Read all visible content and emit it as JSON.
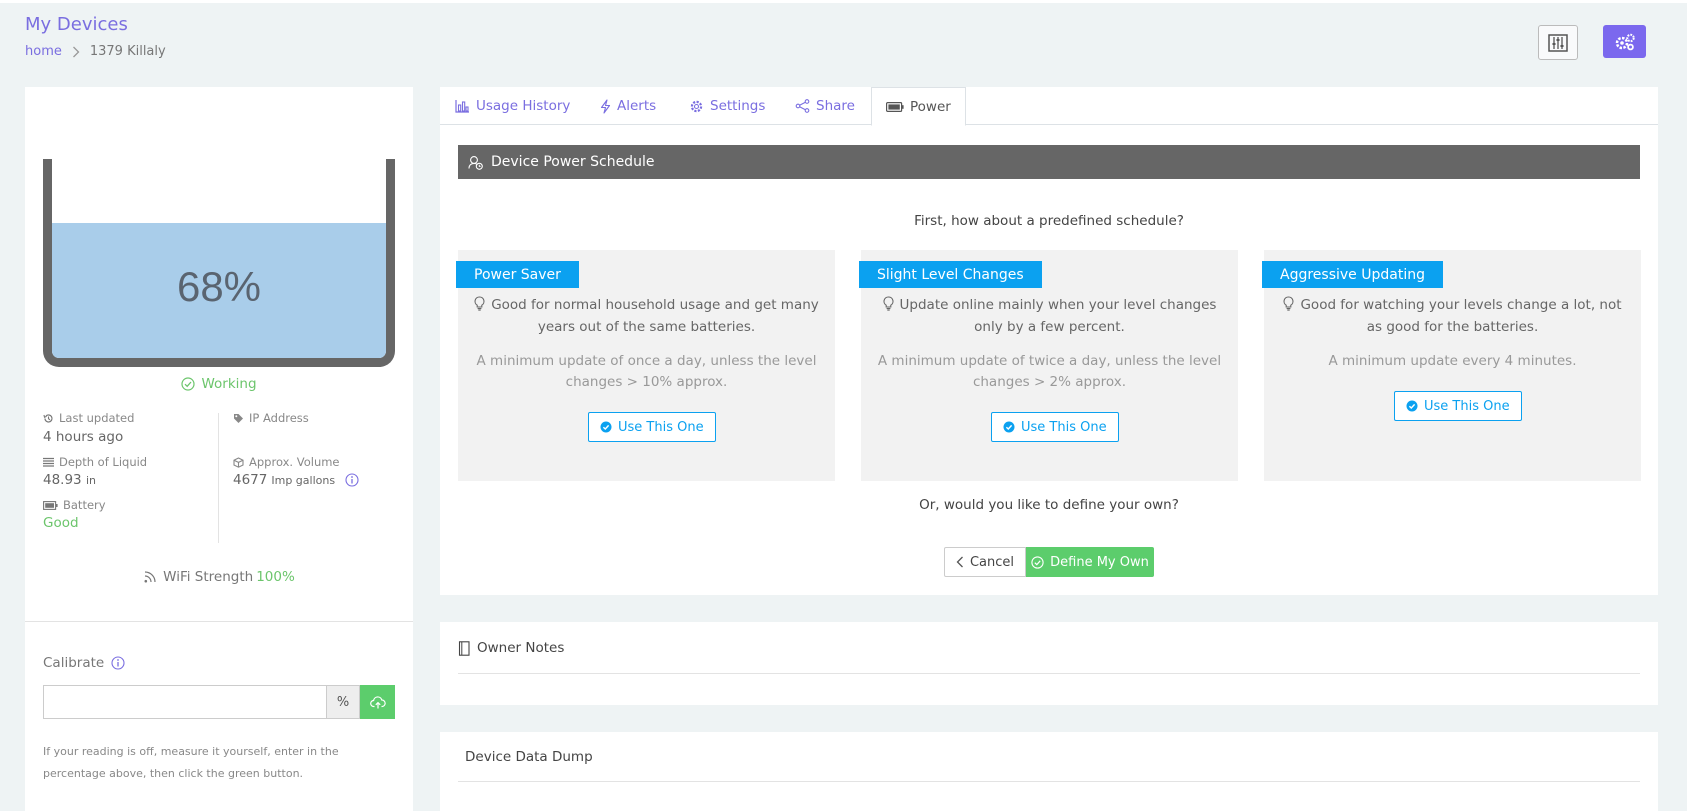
{
  "header": {
    "title": "My Devices",
    "breadcrumb_home": "home",
    "breadcrumb_current": "1379 Killaly"
  },
  "device": {
    "level": "68%",
    "level_fraction": 0.68,
    "status": "Working",
    "last_updated_label": "Last updated",
    "last_updated_value": "4 hours ago",
    "ip_label": "IP Address",
    "depth_label": "Depth of Liquid",
    "depth_value": "48.93",
    "depth_unit": "in",
    "volume_label": "Approx. Volume",
    "volume_value": "4677",
    "volume_unit": "Imp gallons",
    "battery_label": "Battery",
    "battery_value": "Good",
    "wifi_label": "WiFi Strength",
    "wifi_value": "100%"
  },
  "calibrate": {
    "label": "Calibrate",
    "unit": "%",
    "input_value": "",
    "help": "If your reading is off, measure it yourself, enter in the percentage above, then click the green button."
  },
  "tabs": [
    {
      "label": "Usage History",
      "icon": "bar-chart-icon"
    },
    {
      "label": "Alerts",
      "icon": "lightning-icon"
    },
    {
      "label": "Settings",
      "icon": "gear-icon"
    },
    {
      "label": "Share",
      "icon": "share-icon"
    },
    {
      "label": "Power",
      "icon": "battery-icon"
    }
  ],
  "power": {
    "header": "Device Power Schedule",
    "question": "First, how about a predefined schedule?",
    "options": [
      {
        "title": "Power Saver",
        "desc": "Good for normal household usage and get many years out of the same batteries.",
        "min": "A minimum update of once a day, unless the level changes > 10% approx.",
        "button": "Use This One"
      },
      {
        "title": "Slight Level Changes",
        "desc": "Update online mainly when your level changes only by a few percent.",
        "min": "A minimum update of twice a day, unless the level changes > 2% approx.",
        "button": "Use This One"
      },
      {
        "title": "Aggressive Updating",
        "desc": "Good for watching your levels change a lot, not as good for the batteries.",
        "min": "A minimum update every 4 minutes.",
        "button": "Use This One"
      }
    ],
    "define_question": "Or, would you like to define your own?",
    "cancel": "Cancel",
    "define_own": "Define My Own"
  },
  "owner_notes": {
    "title": "Owner Notes"
  },
  "data_dump": {
    "title": "Device Data Dump"
  },
  "colors": {
    "accent": "#7b68ee",
    "info": "#0ba1f0",
    "success": "#5ccd6c",
    "tank_fill": "#a9cdea"
  }
}
